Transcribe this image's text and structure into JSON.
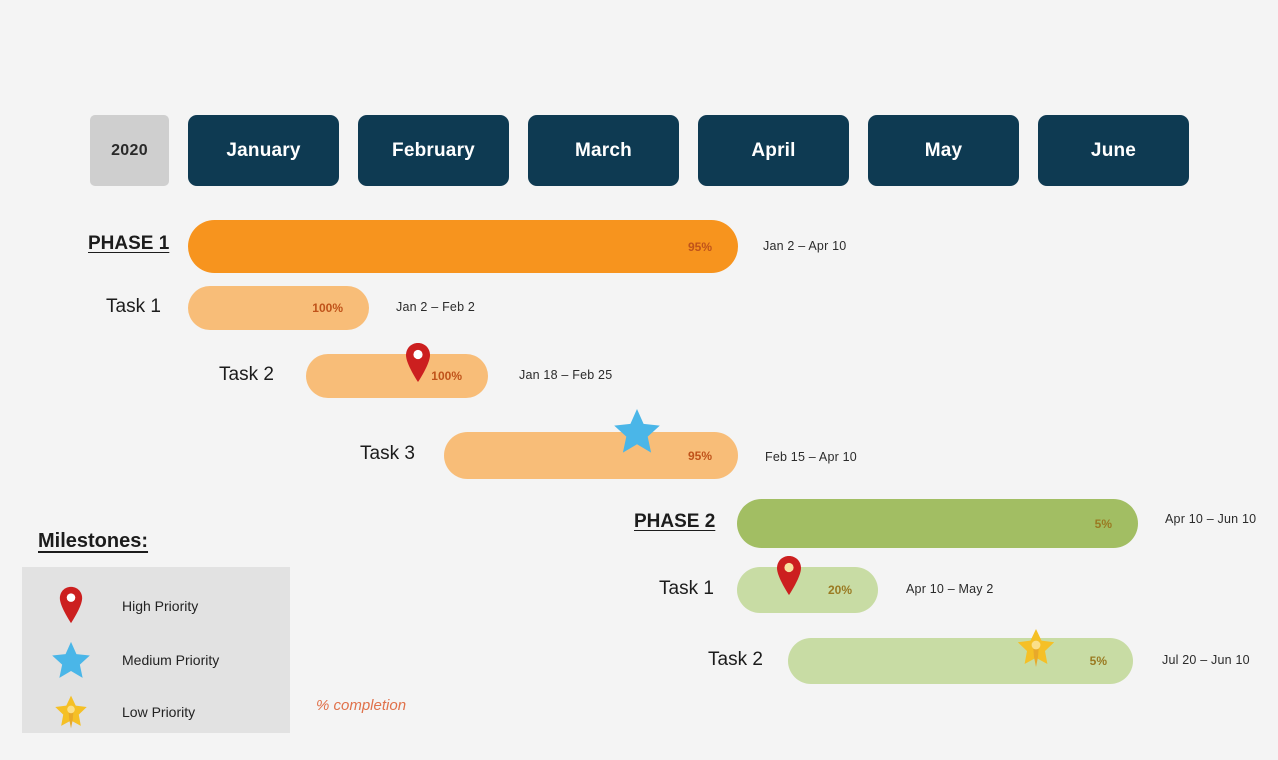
{
  "timeline": {
    "year_label": "2020",
    "months": [
      "January",
      "February",
      "March",
      "April",
      "May",
      "June"
    ]
  },
  "legend": {
    "title": "Milestones:",
    "items": [
      {
        "icon": "map-pin-icon",
        "label": "High Priority",
        "color": "#cc1f1f"
      },
      {
        "icon": "star-icon",
        "label": "Medium Priority",
        "color": "#4ab6e8"
      },
      {
        "icon": "pushpin-icon",
        "label": "Low Priority",
        "color": "#f5c026"
      }
    ],
    "completion_note": "% completion"
  },
  "colors": {
    "header_dark": "#0e3a52",
    "year_grey": "#cfcfcf",
    "phase1_orange": "#f7941e",
    "task_orange": "#f8bd78",
    "phase2_green": "#a2be63",
    "task_green": "#c8dca4",
    "background": "#f4f4f4"
  },
  "chart_data": {
    "type": "gantt",
    "title": "",
    "axis_months": [
      "January",
      "February",
      "March",
      "April",
      "May",
      "June"
    ],
    "year": "2020",
    "rows": [
      {
        "name": "PHASE 1",
        "kind": "phase",
        "percent": "95%",
        "dates": "Jan 2 – Apr 10",
        "start_month": 0.0,
        "end_month": 3.33,
        "color": "#f7941e",
        "milestone": null
      },
      {
        "name": "Task 1",
        "kind": "task",
        "percent": "100%",
        "dates": "Jan 2 – Feb 2",
        "start_month": 0.0,
        "end_month": 1.05,
        "color": "#f8bd78",
        "milestone": null
      },
      {
        "name": "Task 2",
        "kind": "task",
        "percent": "100%",
        "dates": "Jan 18 – Feb 25",
        "start_month": 0.55,
        "end_month": 1.8,
        "color": "#f8bd78",
        "milestone": "map-pin-icon"
      },
      {
        "name": "Task 3",
        "kind": "task",
        "percent": "95%",
        "dates": "Feb 15 – Apr 10",
        "start_month": 1.5,
        "end_month": 3.33,
        "color": "#f8bd78",
        "milestone": "star-icon"
      },
      {
        "name": "PHASE 2",
        "kind": "phase",
        "percent": "5%",
        "dates": "Apr 10 – Jun 10",
        "start_month": 3.33,
        "end_month": 5.6,
        "color": "#a2be63",
        "milestone": null
      },
      {
        "name": "Task 1",
        "kind": "task",
        "percent": "20%",
        "dates": "Apr 10 – May 2",
        "start_month": 3.33,
        "end_month": 4.1,
        "color": "#c8dca4",
        "milestone": "map-pin-icon"
      },
      {
        "name": "Task 2",
        "kind": "task",
        "percent": "5%",
        "dates": "Jul 20 – Jun 10",
        "start_month": 3.7,
        "end_month": 5.6,
        "color": "#c8dca4",
        "milestone": "pushpin-icon"
      }
    ]
  }
}
